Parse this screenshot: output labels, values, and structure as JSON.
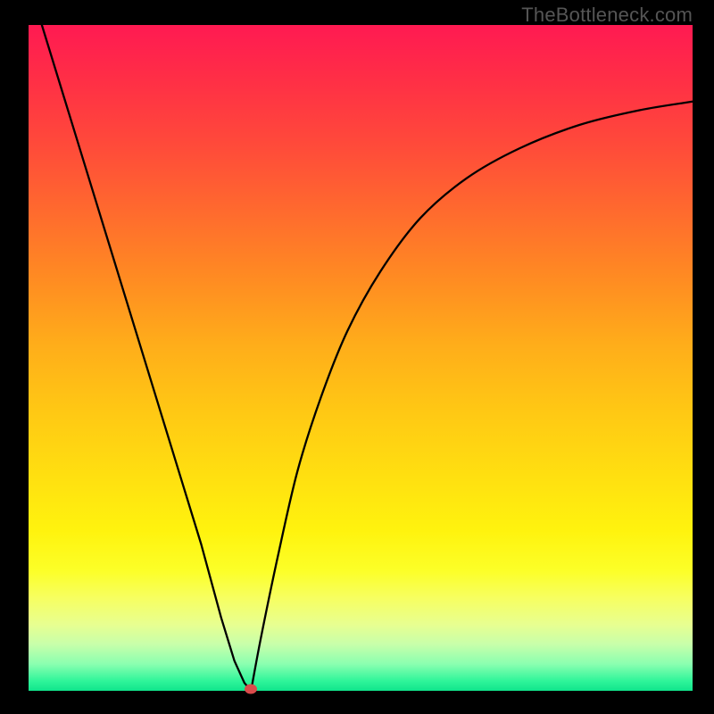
{
  "watermark": "TheBottleneck.com",
  "chart_data": {
    "type": "line",
    "title": "",
    "xlabel": "",
    "ylabel": "",
    "xlim": [
      0,
      1
    ],
    "ylim": [
      0,
      1
    ],
    "series": [
      {
        "name": "left-descent",
        "x": [
          0.02,
          0.06,
          0.1,
          0.14,
          0.18,
          0.22,
          0.26,
          0.29,
          0.31,
          0.325,
          0.335
        ],
        "values": [
          1.0,
          0.87,
          0.74,
          0.61,
          0.48,
          0.35,
          0.22,
          0.11,
          0.045,
          0.012,
          0.0
        ]
      },
      {
        "name": "right-ascent",
        "x": [
          0.335,
          0.35,
          0.375,
          0.405,
          0.44,
          0.48,
          0.53,
          0.59,
          0.66,
          0.74,
          0.83,
          0.92,
          1.0
        ],
        "values": [
          0.0,
          0.08,
          0.2,
          0.33,
          0.44,
          0.54,
          0.63,
          0.71,
          0.77,
          0.815,
          0.85,
          0.872,
          0.885
        ]
      }
    ],
    "marker": {
      "x": 0.335,
      "y": 0.003,
      "color": "#d94b4b"
    },
    "background_gradient": {
      "orientation": "vertical",
      "stops": [
        {
          "pos": 0.0,
          "color": "#ff1a52"
        },
        {
          "pos": 0.28,
          "color": "#ff6a2e"
        },
        {
          "pos": 0.58,
          "color": "#ffc814"
        },
        {
          "pos": 0.82,
          "color": "#fcff28"
        },
        {
          "pos": 0.93,
          "color": "#c8ffaa"
        },
        {
          "pos": 1.0,
          "color": "#10e58c"
        }
      ]
    }
  }
}
